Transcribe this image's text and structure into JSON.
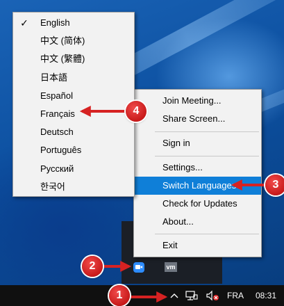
{
  "language_menu": {
    "items": [
      {
        "label": "English",
        "checked": true
      },
      {
        "label": "中文 (简体)",
        "checked": false
      },
      {
        "label": "中文 (繁體)",
        "checked": false
      },
      {
        "label": "日本語",
        "checked": false
      },
      {
        "label": "Español",
        "checked": false
      },
      {
        "label": "Français",
        "checked": false
      },
      {
        "label": "Deutsch",
        "checked": false
      },
      {
        "label": "Português",
        "checked": false
      },
      {
        "label": "Русский",
        "checked": false
      },
      {
        "label": "한국어",
        "checked": false
      }
    ],
    "check_glyph": "✓"
  },
  "zoom_menu": {
    "items": {
      "join_meeting": "Join Meeting...",
      "share_screen": "Share Screen...",
      "sign_in": "Sign in",
      "settings": "Settings...",
      "switch_languages": "Switch Languages",
      "check_updates": "Check for Updates",
      "about": "About...",
      "exit": "Exit"
    },
    "highlight_color": "#0f7fd8"
  },
  "tray_overflow": {
    "vm_label": "vm"
  },
  "taskbar": {
    "language": "FRA",
    "clock": "08:31"
  },
  "callouts": {
    "c1": "1",
    "c2": "2",
    "c3": "3",
    "c4": "4",
    "color": "#d62222"
  }
}
